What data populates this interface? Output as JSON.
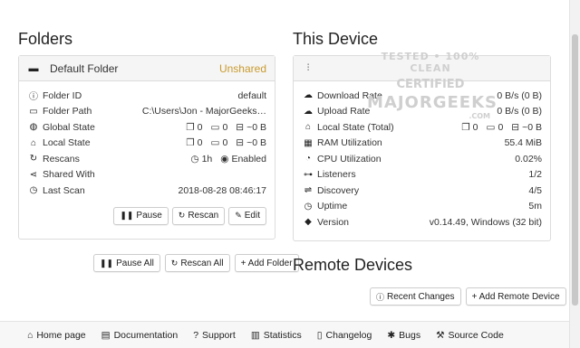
{
  "folders": {
    "heading": "Folders",
    "folder": {
      "name": "Default Folder",
      "status": "Unshared",
      "rows": [
        {
          "icon": "info-icon",
          "label": "Folder ID",
          "value": "default"
        },
        {
          "icon": "folder-open-icon",
          "label": "Folder Path",
          "value": "C:\\Users\\Jon - MajorGeeks…"
        },
        {
          "icon": "globe-icon",
          "label": "Global State",
          "files": "0",
          "dirs": "0",
          "size": "~0 B"
        },
        {
          "icon": "home-icon",
          "label": "Local State",
          "files": "0",
          "dirs": "0",
          "size": "~0 B"
        },
        {
          "icon": "refresh-icon",
          "label": "Rescans",
          "interval": "1h",
          "watch": "Enabled"
        },
        {
          "icon": "share-icon",
          "label": "Shared With",
          "value": ""
        },
        {
          "icon": "clock-icon",
          "label": "Last Scan",
          "value": "2018-08-28 08:46:17"
        }
      ],
      "buttons": {
        "pause": "Pause",
        "rescan": "Rescan",
        "edit": "Edit"
      }
    },
    "actions": {
      "pause_all": "Pause All",
      "rescan_all": "Rescan All",
      "add_folder": "+ Add Folder"
    }
  },
  "device": {
    "heading": "This Device",
    "rows": [
      {
        "icon": "cloud-download-icon",
        "label": "Download Rate",
        "value": "0 B/s (0 B)"
      },
      {
        "icon": "cloud-upload-icon",
        "label": "Upload Rate",
        "value": "0 B/s (0 B)"
      },
      {
        "icon": "home-icon",
        "label": "Local State (Total)",
        "files": "0",
        "dirs": "0",
        "size": "~0 B"
      },
      {
        "icon": "memory-icon",
        "label": "RAM Utilization",
        "value": "55.4 MiB"
      },
      {
        "icon": "tachometer-icon",
        "label": "CPU Utilization",
        "value": "0.02%"
      },
      {
        "icon": "sitemap-icon",
        "label": "Listeners",
        "value": "1/2"
      },
      {
        "icon": "signpost-icon",
        "label": "Discovery",
        "value": "4/5"
      },
      {
        "icon": "clock-icon",
        "label": "Uptime",
        "value": "5m"
      },
      {
        "icon": "tag-icon",
        "label": "Version",
        "value": "v0.14.49, Windows (32 bit)"
      }
    ]
  },
  "remote": {
    "heading": "Remote Devices",
    "recent_changes": "Recent Changes",
    "add_remote": "+ Add Remote Device"
  },
  "footer": {
    "home": "Home page",
    "docs": "Documentation",
    "support": "Support",
    "stats": "Statistics",
    "changelog": "Changelog",
    "bugs": "Bugs",
    "source": "Source Code"
  },
  "watermark": {
    "line1": "TESTED • 100% CLEAN",
    "line2": "CERTIFIED",
    "line3": "MAJORGEEKS",
    "line4": ".COM"
  },
  "colors": {
    "unshared": "#c99a2e",
    "accent": "#333333"
  }
}
